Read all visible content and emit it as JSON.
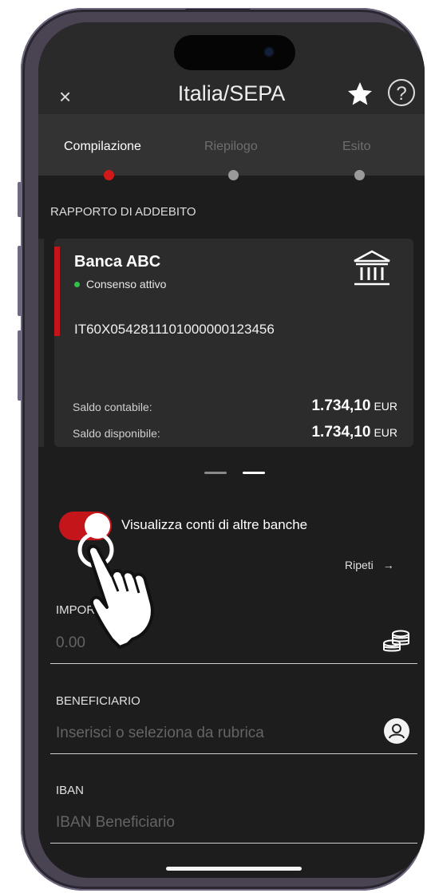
{
  "header": {
    "title": "Italia/SEPA",
    "close_icon": "×",
    "favorite_icon": "star-icon",
    "help_icon": "?"
  },
  "steps": [
    {
      "label": "Compilazione",
      "active": true
    },
    {
      "label": "Riepilogo",
      "active": false
    },
    {
      "label": "Esito",
      "active": false
    }
  ],
  "debit_section": {
    "label": "RAPPORTO DI ADDEBITO"
  },
  "account": {
    "bank_name": "Banca ABC",
    "status": "Consenso attivo",
    "iban": "IT60X0542811101000000123456",
    "balance_accounting_label": "Saldo contabile:",
    "balance_accounting_value": "1.734,10",
    "balance_available_label": "Saldo disponibile:",
    "balance_available_value": "1.734,10",
    "currency": "EUR"
  },
  "toggle": {
    "label": "Visualizza conti di altre banche",
    "on": true
  },
  "repeat": {
    "label": "Ripeti",
    "arrow": "→"
  },
  "amount": {
    "label": "IMPORTO",
    "placeholder": "0.00"
  },
  "beneficiary": {
    "label": "BENEFICIARIO",
    "placeholder": "Inserisci o seleziona da rubrica"
  },
  "iban_field": {
    "label": "IBAN",
    "placeholder": "IBAN Beneficiario"
  },
  "colors": {
    "accent": "#c4151b",
    "background": "#1d1d1d",
    "header": "#2a2a2a",
    "status_dot": "#2ec44a"
  }
}
